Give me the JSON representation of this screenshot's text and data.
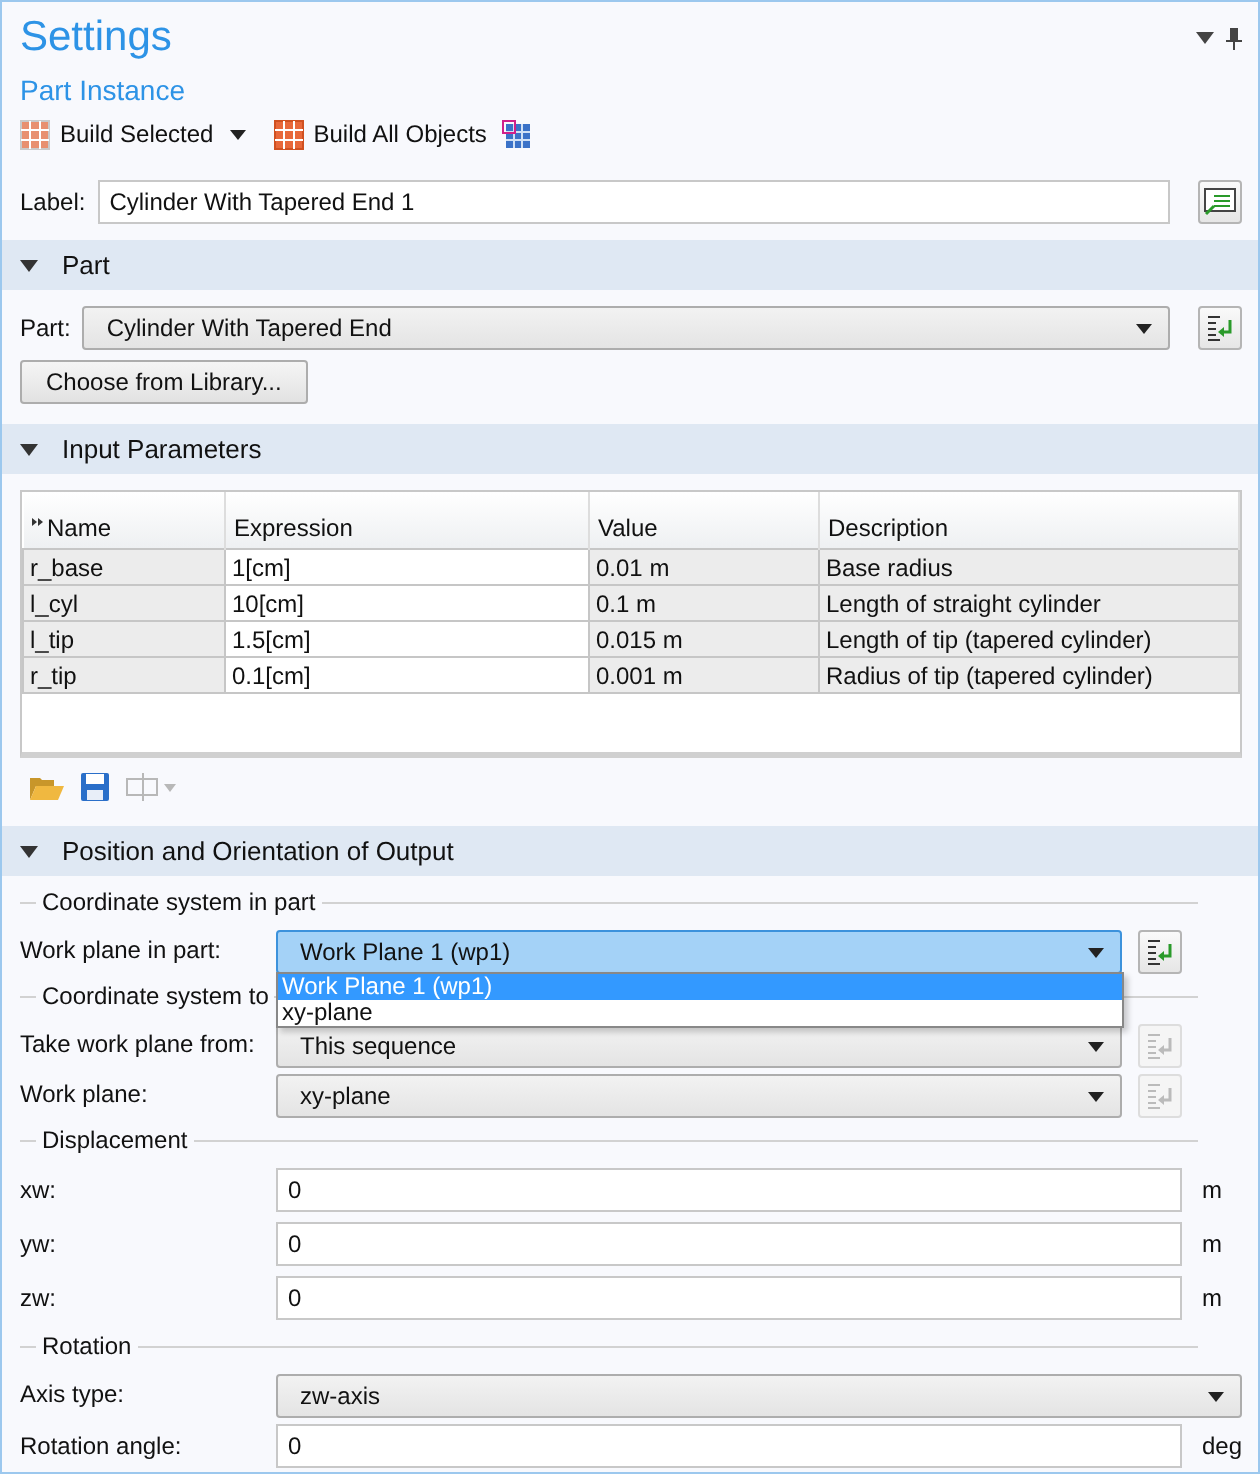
{
  "header": {
    "title": "Settings",
    "subtitle": "Part Instance"
  },
  "toolbar": [
    {
      "kind": "split",
      "label": "Build Selected"
    },
    {
      "kind": "button",
      "label": "Build All Objects"
    },
    {
      "kind": "icon"
    }
  ],
  "label_row": {
    "label": "Label:",
    "value": "Cylinder With Tapered End 1"
  },
  "part_section": {
    "title": "Part",
    "expanded": true,
    "part_label": "Part:",
    "part_value": "Cylinder With Tapered End",
    "library_button": "Choose from Library..."
  },
  "parameters_section": {
    "title": "Input Parameters",
    "expanded": true,
    "table": {
      "columns": [
        "Name",
        "Expression",
        "Value",
        "Description"
      ],
      "rows": [
        [
          "r_base",
          "1[cm]",
          "0.01 m",
          "Base radius"
        ],
        [
          "l_cyl",
          "10[cm]",
          "0.1 m",
          "Length of straight cylinder"
        ],
        [
          "l_tip",
          "1.5[cm]",
          "0.015 m",
          "Length of tip (tapered cylinder)"
        ],
        [
          "r_tip",
          "0.1[cm]",
          "0.001 m",
          "Radius of tip (tapered cylinder)"
        ]
      ]
    },
    "tools": [
      {
        "kind": "open",
        "disabled": false
      },
      {
        "kind": "save",
        "disabled": false
      },
      {
        "kind": "split",
        "disabled": true
      }
    ]
  },
  "output_section": {
    "title": "Position and Orientation of Output",
    "expanded": true,
    "rows": [
      {
        "kind": "group",
        "label": "Coordinate system in part"
      },
      {
        "kind": "combo",
        "label": "Work plane in part:",
        "value": "Work Plane 1 (wp1)",
        "focused": true,
        "side_button": {
          "disabled": false
        },
        "open": true,
        "options": [
          {
            "label": "Work Plane 1 (wp1)",
            "selected": true
          },
          {
            "label": "xy-plane",
            "selected": false
          }
        ]
      },
      {
        "kind": "group",
        "label": "Coordinate system to"
      },
      {
        "kind": "combo",
        "label": "Take work plane from:",
        "value": "This sequence",
        "focused": false,
        "side_button": {
          "disabled": true
        }
      },
      {
        "kind": "combo",
        "label": "Work plane:",
        "value": "xy-plane",
        "focused": false,
        "side_button": {
          "disabled": true
        }
      },
      {
        "kind": "group",
        "label": "Displacement"
      },
      {
        "kind": "field",
        "label": "xw:",
        "value": "0",
        "unit": "m"
      },
      {
        "kind": "field",
        "label": "yw:",
        "value": "0",
        "unit": "m"
      },
      {
        "kind": "field",
        "label": "zw:",
        "value": "0",
        "unit": "m"
      },
      {
        "kind": "group",
        "label": "Rotation"
      },
      {
        "kind": "combo",
        "label": "Axis type:",
        "value": "zw-axis",
        "focused": false
      },
      {
        "kind": "field",
        "label": "Rotation angle:",
        "value": "0",
        "unit": "deg"
      }
    ]
  }
}
